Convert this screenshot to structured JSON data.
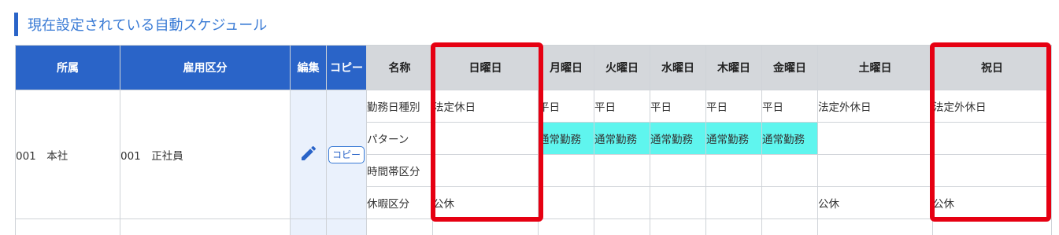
{
  "section_title": "現在設定されている自動スケジュール",
  "headers": {
    "affiliation": "所属",
    "employment_type": "雇用区分",
    "edit": "編集",
    "copy": "コピー",
    "name": "名称",
    "days": [
      "日曜日",
      "月曜日",
      "火曜日",
      "水曜日",
      "木曜日",
      "金曜日",
      "土曜日",
      "祝日"
    ]
  },
  "record": {
    "affiliation": "001　本社",
    "employment_type": "001　正社員",
    "edit_icon": "pencil-icon",
    "copy_button_label": "コピー",
    "rows": [
      {
        "label": "勤務日種別",
        "values": [
          "法定休日",
          "平日",
          "平日",
          "平日",
          "平日",
          "平日",
          "法定外休日",
          "法定外休日"
        ]
      },
      {
        "label": "パターン",
        "values": [
          "",
          "通常勤務",
          "通常勤務",
          "通常勤務",
          "通常勤務",
          "通常勤務",
          "",
          ""
        ]
      },
      {
        "label": "時間帯区分",
        "values": [
          "",
          "",
          "",
          "",
          "",
          "",
          "",
          ""
        ]
      },
      {
        "label": "休暇区分",
        "values": [
          "公休",
          "",
          "",
          "",
          "",
          "",
          "公休",
          "公休"
        ]
      }
    ]
  },
  "colors": {
    "header_blue": "#2a64c8",
    "header_gray": "#d4d7db",
    "pattern_cyan": "#5ff5ee",
    "highlight_red": "#e60012"
  }
}
